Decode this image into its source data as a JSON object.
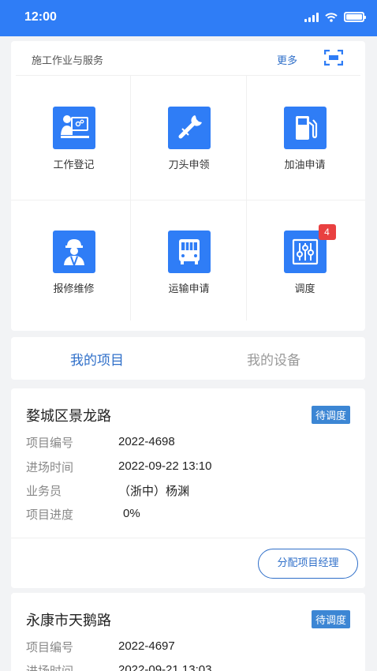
{
  "status_bar": {
    "time": "12:00"
  },
  "services": {
    "title": "施工作业与服务",
    "more_label": "更多",
    "items": [
      {
        "label": "工作登记",
        "icon": "work-register-icon"
      },
      {
        "label": "刀头申领",
        "icon": "tool-icon"
      },
      {
        "label": "加油申请",
        "icon": "fuel-pump-icon"
      },
      {
        "label": "报修维修",
        "icon": "worker-icon"
      },
      {
        "label": "运输申请",
        "icon": "truck-icon"
      },
      {
        "label": "调度",
        "icon": "dispatch-sliders-icon",
        "badge": "4"
      }
    ]
  },
  "tabs": [
    {
      "label": "我的项目",
      "active": true
    },
    {
      "label": "我的设备",
      "active": false
    }
  ],
  "field_labels": {
    "number": "项目编号",
    "entry_time": "进场时间",
    "salesperson": "业务员",
    "progress": "项目进度"
  },
  "projects": [
    {
      "name": "婺城区景龙路",
      "status": "待调度",
      "number": "2022-4698",
      "entry_time": "2022-09-22 13:10",
      "salesperson": "（浙中）杨渊",
      "progress": "0%",
      "action_label": "分配项目经理"
    },
    {
      "name": "永康市天鹅路",
      "status": "待调度",
      "number": "2022-4697",
      "entry_time": "2022-09-21 13:03"
    }
  ],
  "colors": {
    "primary": "#2f7df6",
    "link": "#2f6fc9",
    "badge": "#e94040",
    "status": "#3c86d4"
  }
}
